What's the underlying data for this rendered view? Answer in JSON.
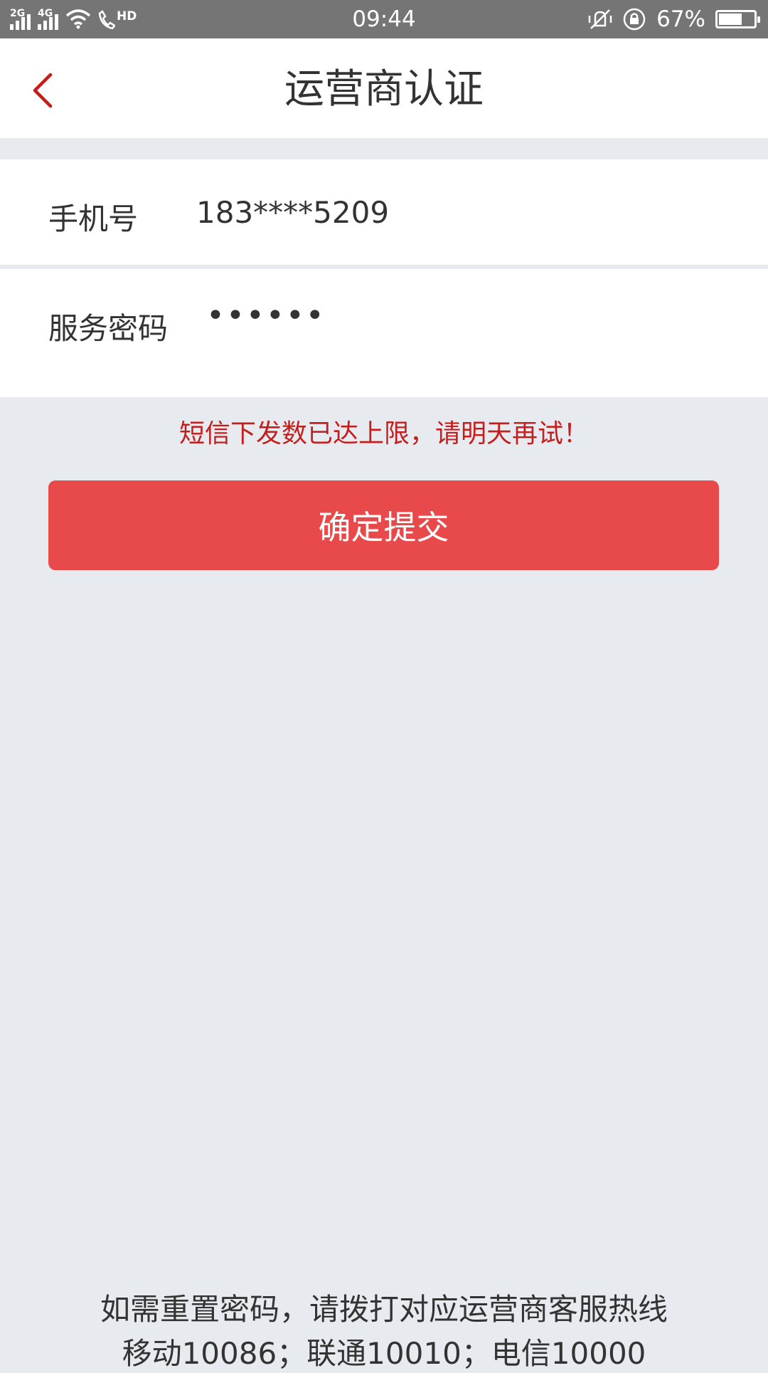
{
  "status_bar": {
    "signal1_tag": "2G",
    "signal2_tag": "4G",
    "hd_label": "HD",
    "time": "09:44",
    "battery_percent": "67%",
    "battery_level": 0.67
  },
  "header": {
    "title": "运营商认证",
    "back_icon": "chevron-left-icon",
    "accent_color": "#c91a1a"
  },
  "form": {
    "phone_label": "手机号",
    "phone_value": "183****5209",
    "password_label": "服务密码",
    "password_value": "••••••"
  },
  "error_message": "短信下发数已达上限，请明天再试！",
  "submit_label": "确定提交",
  "submit_color": "#e8494a",
  "footer": {
    "line1": "如需重置密码，请拨打对应运营商客服热线",
    "line2": "移动10086；联通10010；电信10000"
  }
}
